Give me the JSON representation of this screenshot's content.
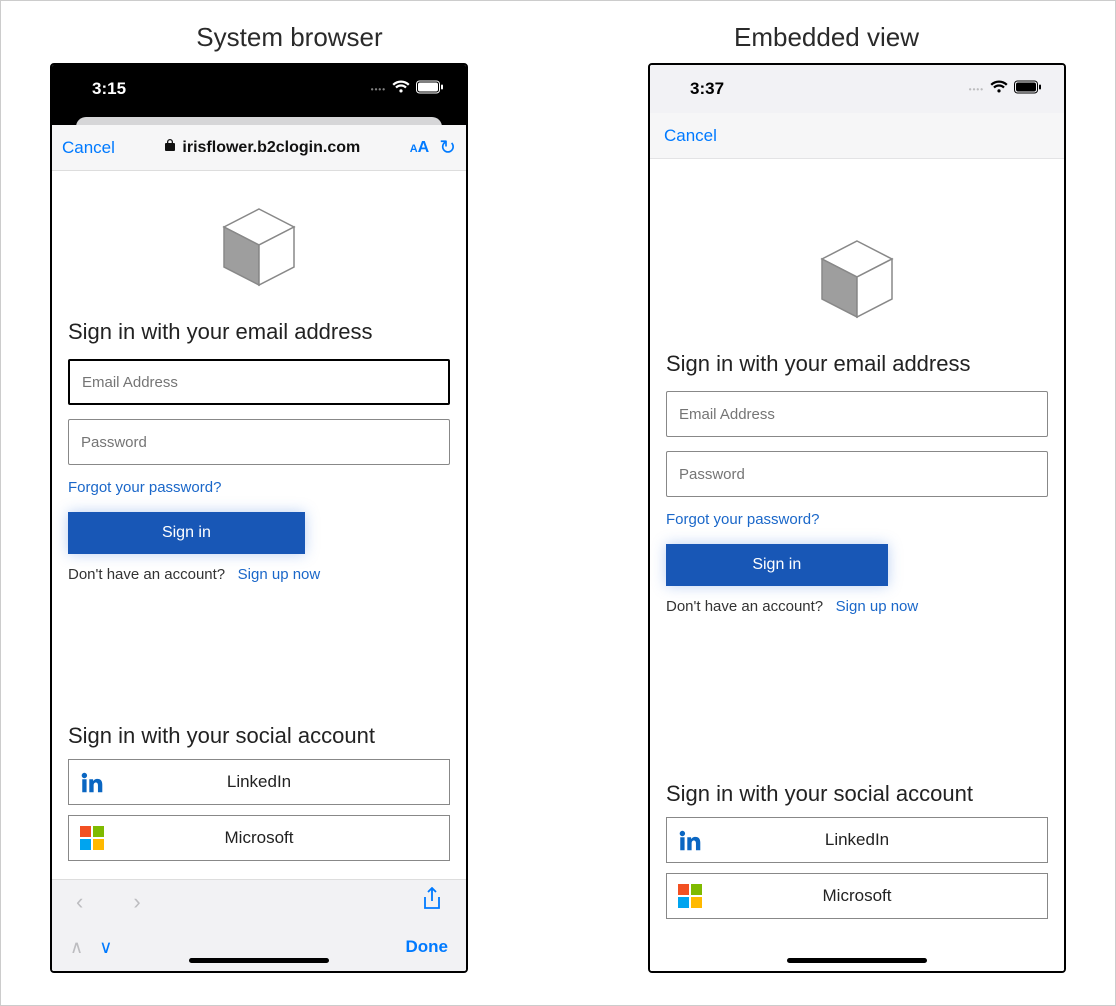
{
  "titles": {
    "left": "System browser",
    "right": "Embedded view"
  },
  "status": {
    "left_time": "3:15",
    "right_time": "3:37"
  },
  "browser": {
    "cancel": "Cancel",
    "url": "irisflower.b2clogin.com",
    "aa_small": "A",
    "aa_large": "A",
    "done": "Done"
  },
  "signin": {
    "heading": "Sign in with your email address",
    "email_placeholder": "Email Address",
    "password_placeholder": "Password",
    "forgot": "Forgot your password?",
    "button": "Sign in",
    "noaccount_text": "Don't have an account?",
    "signup": "Sign up now"
  },
  "social": {
    "heading": "Sign in with your social account",
    "linkedin": "LinkedIn",
    "microsoft": "Microsoft"
  }
}
